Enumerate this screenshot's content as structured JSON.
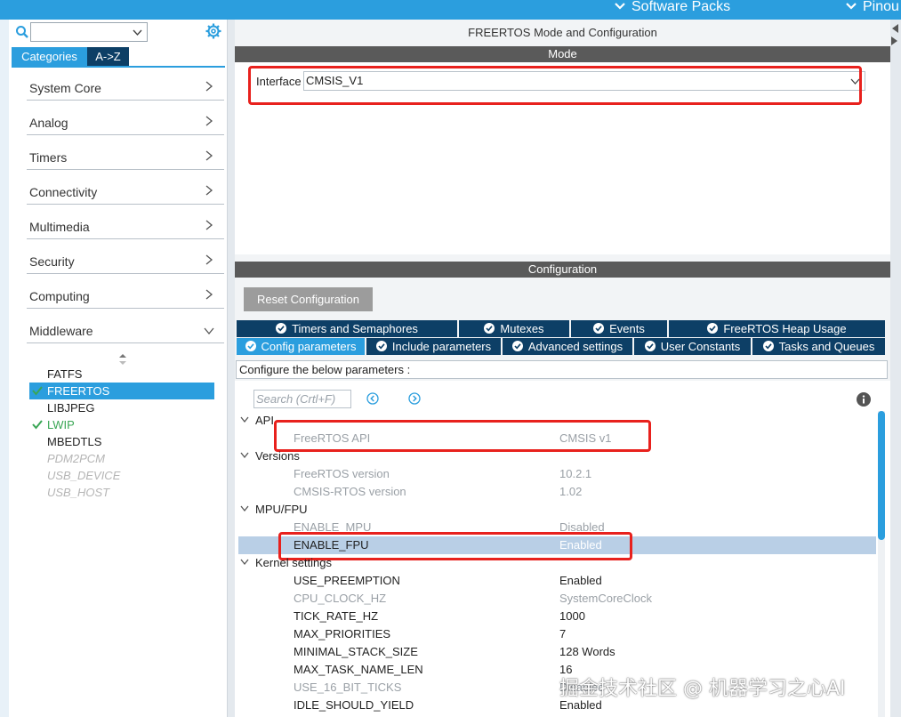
{
  "topbar": {
    "software_packs": "Software Packs",
    "pinout": "Pinou",
    "icons": [
      "chevron-down-icon"
    ]
  },
  "sidebar": {
    "search_icon": "search-icon",
    "category_select_value": "",
    "settings_icon": "gear-icon",
    "tabs": [
      "Categories",
      "A->Z"
    ],
    "categories": [
      {
        "label": "System Core",
        "icon": "chevron-right-icon"
      },
      {
        "label": "Analog",
        "icon": "chevron-right-icon"
      },
      {
        "label": "Timers",
        "icon": "chevron-right-icon"
      },
      {
        "label": "Connectivity",
        "icon": "chevron-right-icon"
      },
      {
        "label": "Multimedia",
        "icon": "chevron-right-icon"
      },
      {
        "label": "Security",
        "icon": "chevron-right-icon"
      },
      {
        "label": "Computing",
        "icon": "chevron-right-icon"
      },
      {
        "label": "Middleware",
        "icon": "chevron-down-icon"
      }
    ],
    "middleware_items": [
      {
        "label": "FATFS",
        "state": "normal"
      },
      {
        "label": "FREERTOS",
        "state": "selected"
      },
      {
        "label": "LIBJPEG",
        "state": "normal"
      },
      {
        "label": "LWIP",
        "state": "enabled"
      },
      {
        "label": "MBEDTLS",
        "state": "normal"
      },
      {
        "label": "PDM2PCM",
        "state": "disabled"
      },
      {
        "label": "USB_DEVICE",
        "state": "disabled"
      },
      {
        "label": "USB_HOST",
        "state": "disabled"
      }
    ]
  },
  "main": {
    "title": "FREERTOS Mode and Configuration",
    "mode_header": "Mode",
    "interface_label": "Interface",
    "interface_value": "CMSIS_V1",
    "config_header": "Configuration",
    "reset_button": "Reset Configuration",
    "tabs_row1": [
      "Timers and Semaphores",
      "Mutexes",
      "Events",
      "FreeRTOS Heap Usage"
    ],
    "tabs_row2": [
      "Config parameters",
      "Include parameters",
      "Advanced settings",
      "User Constants",
      "Tasks and Queues"
    ],
    "active_tab": "Config parameters",
    "config_hint": "Configure the below parameters :",
    "search_placeholder": "Search (Crtl+F)",
    "groups": {
      "api": "API",
      "versions": "Versions",
      "mpu_fpu": "MPU/FPU",
      "kernel": "Kernel settings"
    },
    "params": [
      {
        "name": "FreeRTOS API",
        "value": "CMSIS v1",
        "dim": true
      },
      {
        "name": "FreeRTOS version",
        "value": "10.2.1",
        "dim": true
      },
      {
        "name": "CMSIS-RTOS version",
        "value": "1.02",
        "dim": true
      },
      {
        "name": "ENABLE_MPU",
        "value": "Disabled",
        "dim": true
      },
      {
        "name": "ENABLE_FPU",
        "value": "Enabled",
        "dim": false
      },
      {
        "name": "USE_PREEMPTION",
        "value": "Enabled",
        "dim": false
      },
      {
        "name": "CPU_CLOCK_HZ",
        "value": "SystemCoreClock",
        "dim": true
      },
      {
        "name": "TICK_RATE_HZ",
        "value": "1000",
        "dim": false
      },
      {
        "name": "MAX_PRIORITIES",
        "value": "7",
        "dim": false
      },
      {
        "name": "MINIMAL_STACK_SIZE",
        "value": "128 Words",
        "dim": false
      },
      {
        "name": "MAX_TASK_NAME_LEN",
        "value": "16",
        "dim": false
      },
      {
        "name": "USE_16_BIT_TICKS",
        "value": "Disabled",
        "dim": true
      },
      {
        "name": "IDLE_SHOULD_YIELD",
        "value": "Enabled",
        "dim": false
      }
    ]
  },
  "watermark": "掘金技术社区 @ 机器学习之心AI",
  "colors": {
    "accent": "#2b9ede",
    "dark_tab": "#0d3f66",
    "section_header": "#5a5a5a",
    "highlight": "#e8211d",
    "selected_row": "#b9cfe6",
    "enabled_green": "#3aa655"
  }
}
